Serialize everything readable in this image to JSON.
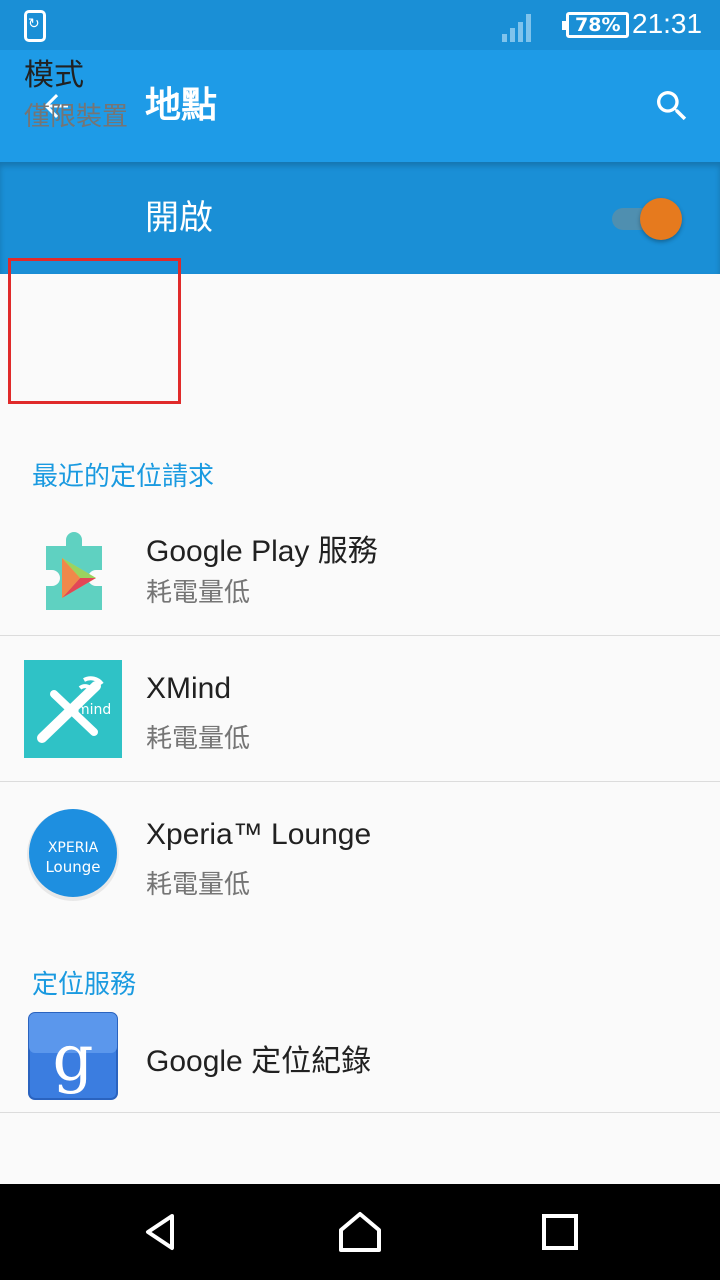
{
  "status_bar": {
    "battery": "78%",
    "time": "21:31",
    "icons": [
      "sync-icon",
      "signal-icon",
      "battery-icon"
    ]
  },
  "app_bar": {
    "title": "地點",
    "back_icon": "arrow-back-icon",
    "search_icon": "search-icon"
  },
  "master_switch": {
    "label": "開啟",
    "state": "on",
    "accent_color": "#e67a1e"
  },
  "mode": {
    "title": "模式",
    "value": "僅限裝置"
  },
  "recent_requests": {
    "header": "最近的定位請求",
    "items": [
      {
        "name": "Google Play 服務",
        "usage": "耗電量低",
        "icon": "google-play-services-icon"
      },
      {
        "name": "XMind",
        "usage": "耗電量低",
        "icon": "xmind-icon"
      },
      {
        "name": "Xperia™ Lounge",
        "usage": "耗電量低",
        "icon": "xperia-lounge-icon",
        "icon_text_1": "XPERIA",
        "icon_text_2": "Lounge"
      }
    ]
  },
  "location_services": {
    "header": "定位服務",
    "items": [
      {
        "name": "Google 定位紀錄",
        "icon": "google-location-history-icon",
        "icon_text": "g"
      }
    ]
  },
  "nav_bar": {
    "icons": [
      "nav-back-icon",
      "nav-home-icon",
      "nav-recents-icon"
    ]
  },
  "colors": {
    "app_bar": "#1e9be7",
    "status_bar": "#1a8fd6",
    "section_header": "#1a9ae0",
    "highlight_box": "#e02a2a"
  }
}
